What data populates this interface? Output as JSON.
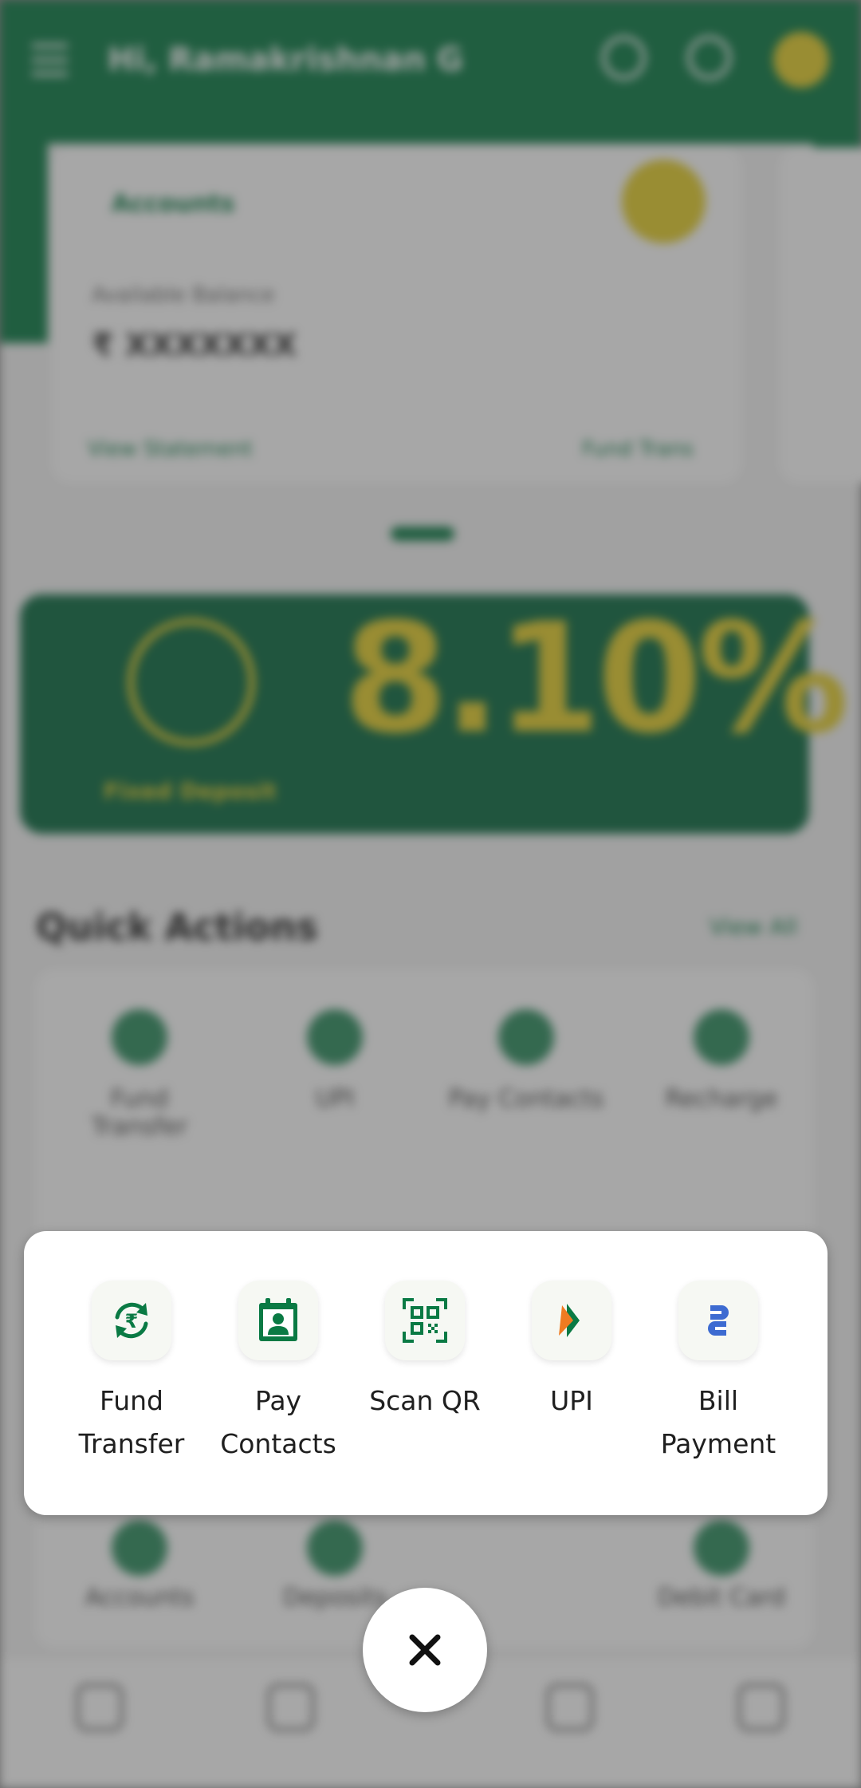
{
  "background": {
    "header": {
      "greeting": "Hi, Ramakrishnan G"
    },
    "account_card": {
      "title": "Accounts",
      "balance_label": "Available Balance",
      "balance_masked": "₹ XXXXXXX",
      "link_left": "View Statement",
      "link_right": "Fund Trans"
    },
    "banner": {
      "rate": "8.10%",
      "subtitle": "Fixed Deposit"
    },
    "quick_actions": {
      "title": "Quick Actions",
      "view_all": "View All",
      "items": [
        "Fund Transfer",
        "UPI",
        "Pay Contacts",
        "Recharge"
      ],
      "bottom_items": [
        "Accounts",
        "Deposits",
        "Debit Card"
      ]
    }
  },
  "action_sheet": {
    "items": [
      {
        "label_line1": "Fund",
        "label_line2": "Transfer",
        "icon": "rupee-sync-icon"
      },
      {
        "label_line1": "Pay",
        "label_line2": "Contacts",
        "icon": "contact-card-icon"
      },
      {
        "label_line1": "Scan QR",
        "label_line2": "",
        "icon": "qr-code-icon"
      },
      {
        "label_line1": "UPI",
        "label_line2": "",
        "icon": "upi-logo-icon"
      },
      {
        "label_line1": "Bill",
        "label_line2": "Payment",
        "icon": "bill-payment-icon"
      }
    ]
  },
  "close": {
    "icon": "close-icon"
  },
  "colors": {
    "brand_green": "#0a7a44",
    "accent_yellow": "#e6cf2c",
    "bill_blue": "#3d6bd1",
    "upi_orange": "#f07b21"
  }
}
